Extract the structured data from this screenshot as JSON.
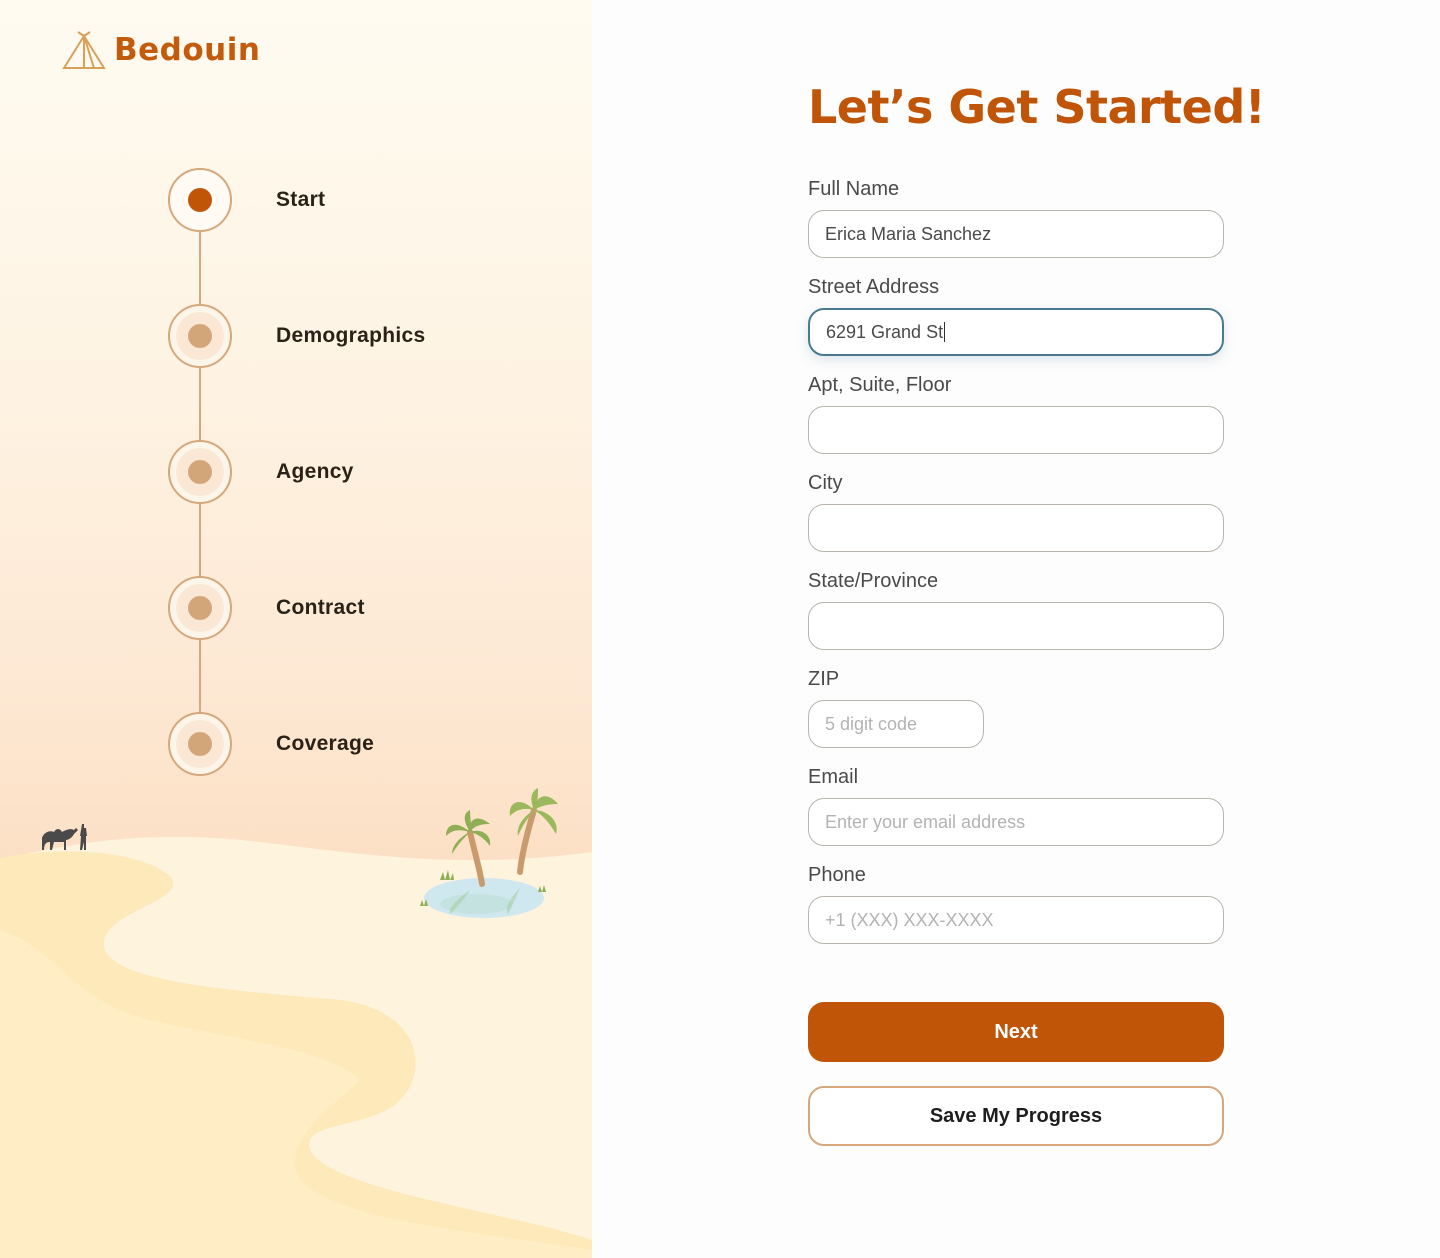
{
  "brand": {
    "name": "Bedouin",
    "color": "#c25b0c"
  },
  "steps": [
    {
      "label": "Start",
      "active": true
    },
    {
      "label": "Demographics",
      "active": false
    },
    {
      "label": "Agency",
      "active": false
    },
    {
      "label": "Contract",
      "active": false
    },
    {
      "label": "Coverage",
      "active": false
    }
  ],
  "form": {
    "title": "Let’s Get Started!",
    "full_name": {
      "label": "Full Name",
      "value": "Erica Maria Sanchez"
    },
    "street": {
      "label": "Street Address",
      "value": "6291 Grand St"
    },
    "apt": {
      "label": "Apt, Suite, Floor",
      "value": ""
    },
    "city": {
      "label": "City",
      "value": ""
    },
    "state": {
      "label": "State/Province",
      "value": ""
    },
    "zip": {
      "label": "ZIP",
      "placeholder": "5 digit code"
    },
    "email": {
      "label": "Email",
      "placeholder": "Enter your email address"
    },
    "phone": {
      "label": "Phone",
      "placeholder": "+1 (XXX) XXX-XXXX"
    }
  },
  "buttons": {
    "next": "Next",
    "save": "Save My Progress"
  },
  "colors": {
    "accent": "#c05407",
    "step_border": "#d6a77a",
    "focus": "#4a7a90"
  }
}
